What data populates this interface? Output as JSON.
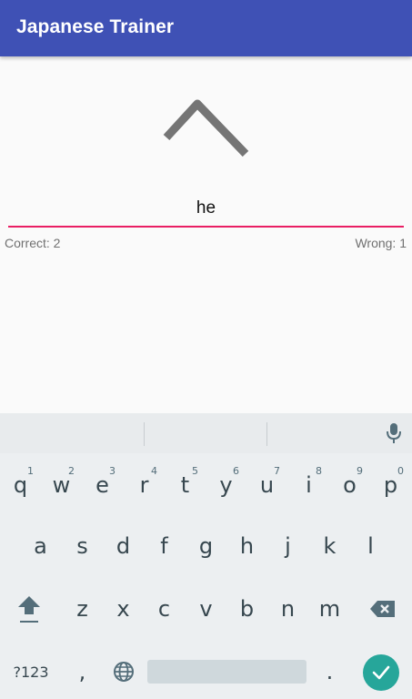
{
  "app": {
    "title": "Japanese Trainer"
  },
  "quiz": {
    "kana_icon": "hiragana-he-glyph",
    "answer_value": "he",
    "correct_label": "Correct: 2",
    "wrong_label": "Wrong: 1"
  },
  "colors": {
    "appbar": "#3f51b5",
    "accent_underline": "#e91e63",
    "enter_key": "#26a69a",
    "keyboard_bg": "#eceff1"
  },
  "keyboard": {
    "row1": [
      {
        "label": "q",
        "hint": "1"
      },
      {
        "label": "w",
        "hint": "2"
      },
      {
        "label": "e",
        "hint": "3"
      },
      {
        "label": "r",
        "hint": "4"
      },
      {
        "label": "t",
        "hint": "5"
      },
      {
        "label": "y",
        "hint": "6"
      },
      {
        "label": "u",
        "hint": "7"
      },
      {
        "label": "i",
        "hint": "8"
      },
      {
        "label": "o",
        "hint": "9"
      },
      {
        "label": "p",
        "hint": "0"
      }
    ],
    "row2": [
      "a",
      "s",
      "d",
      "f",
      "g",
      "h",
      "j",
      "k",
      "l"
    ],
    "row3": [
      "z",
      "x",
      "c",
      "v",
      "b",
      "n",
      "m"
    ],
    "symbols_label": "?123",
    "comma_label": ",",
    "period_label": ".",
    "icons": {
      "mic": "mic-icon",
      "shift": "shift-icon",
      "backspace": "backspace-icon",
      "globe": "globe-icon",
      "enter": "check-icon"
    }
  }
}
